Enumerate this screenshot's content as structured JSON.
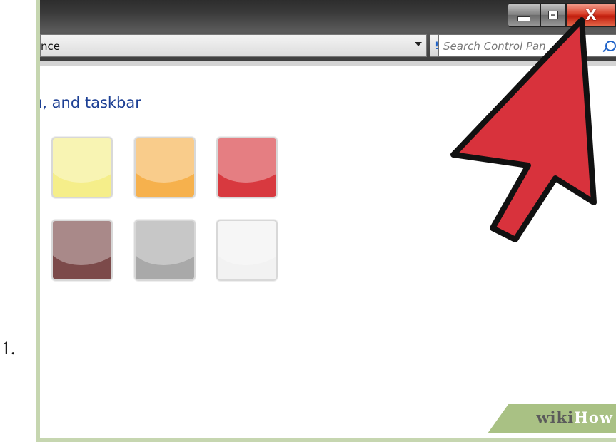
{
  "step": {
    "number": "1."
  },
  "window": {
    "controls": {
      "close_label": "X"
    },
    "address": {
      "text": "nce"
    },
    "search": {
      "placeholder": "Search Control Pan"
    },
    "heading": "u, and taskbar",
    "colors": [
      {
        "name": "yellow",
        "hex": "#f5ee8a"
      },
      {
        "name": "orange",
        "hex": "#f6b14d"
      },
      {
        "name": "red",
        "hex": "#d8393f"
      },
      {
        "name": "brown",
        "hex": "#7c4a4a"
      },
      {
        "name": "gray",
        "hex": "#a9a9a9"
      },
      {
        "name": "white",
        "hex": "#f2f2f2"
      }
    ]
  },
  "annotation": {
    "arrow_color": "#d8323c"
  },
  "watermark": {
    "wiki": "wiki",
    "how": "How"
  }
}
